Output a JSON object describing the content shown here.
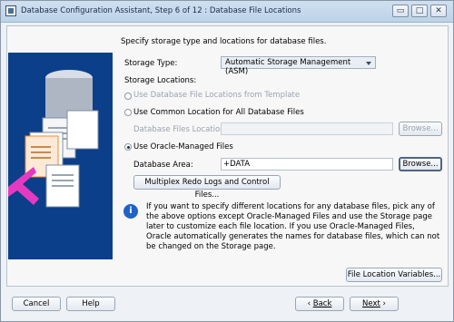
{
  "window": {
    "title": "Database Configuration Assistant, Step 6 of 12 : Database File Locations",
    "controls": [
      "▭",
      "□",
      "✕"
    ]
  },
  "description": "Specify storage type and locations for database files.",
  "storage_type": {
    "label": "Storage Type:",
    "value": "Automatic Storage Management (ASM)"
  },
  "storage_locations_label": "Storage Locations:",
  "options": {
    "template": "Use Database File Locations from Template",
    "common": "Use Common Location for All Database Files",
    "database_files_location_label": "Database Files Location:",
    "database_files_location_value": "",
    "browse_disabled": "Browse...",
    "oracle_managed": "Use Oracle-Managed Files",
    "database_area_label": "Database Area:",
    "database_area_value": "+DATA",
    "browse": "Browse...",
    "multiplex": "Multiplex Redo Logs and Control Files..."
  },
  "info": {
    "icon": "info-icon",
    "text": "If you want to specify different locations for any database files, pick any of the above options except Oracle-Managed Files and use the Storage page later to customize each file location. If you use Oracle-Managed Files, Oracle automatically generates the names for database files, which can not be changed on the Storage page."
  },
  "file_location_variables": "File Location Variables...",
  "bottom": {
    "cancel": "Cancel",
    "help": "Help",
    "back": "Back",
    "next": "Next"
  }
}
